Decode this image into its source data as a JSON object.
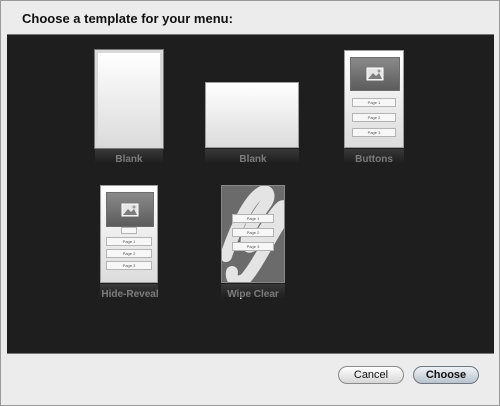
{
  "dialog": {
    "prompt": "Choose a template for your menu:"
  },
  "templates": [
    {
      "name": "Blank",
      "orientation": "portrait",
      "selected": true
    },
    {
      "name": "Blank",
      "orientation": "landscape",
      "selected": false
    },
    {
      "name": "Buttons",
      "pages": [
        "Page 1",
        "Page 2",
        "Page 3"
      ],
      "selected": false
    },
    {
      "name": "Hide-Reveal",
      "pages": [
        "Page 1",
        "Page 2",
        "Page 3"
      ],
      "selected": false
    },
    {
      "name": "Wipe Clear",
      "pages": [
        "Page 1",
        "Page 2",
        "Page 3"
      ],
      "selected": false
    }
  ],
  "buttons": {
    "cancel": "Cancel",
    "choose": "Choose"
  },
  "icons": {
    "picture": "picture-icon"
  },
  "colors": {
    "chooser_background": "#1e1e1e",
    "dialog_background": "#ececec"
  }
}
